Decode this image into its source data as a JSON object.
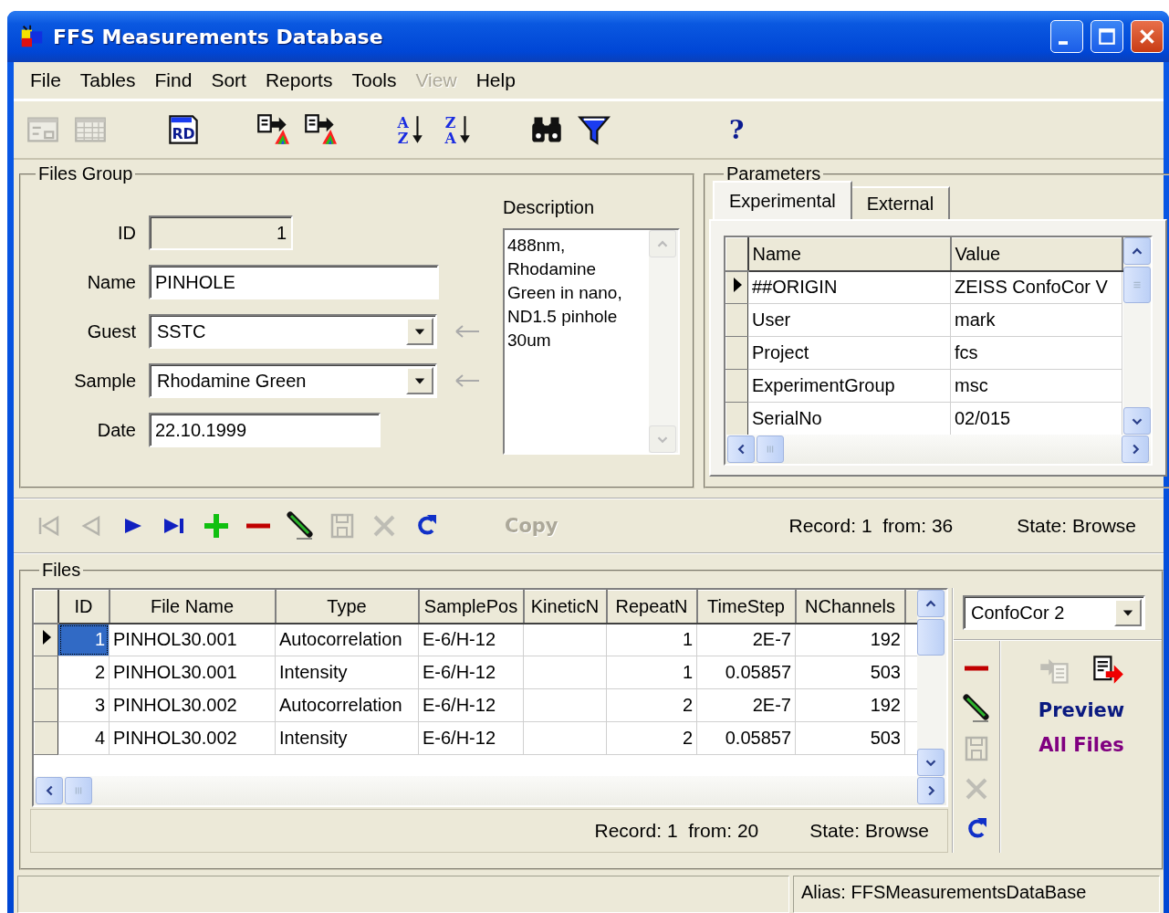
{
  "window": {
    "title": "FFS Measurements Database"
  },
  "menu": [
    {
      "label": "File",
      "disabled": false
    },
    {
      "label": "Tables",
      "disabled": false
    },
    {
      "label": "Find",
      "disabled": false
    },
    {
      "label": "Sort",
      "disabled": false
    },
    {
      "label": "Reports",
      "disabled": false
    },
    {
      "label": "Tools",
      "disabled": false
    },
    {
      "label": "View",
      "disabled": true
    },
    {
      "label": "Help",
      "disabled": false
    }
  ],
  "toolbar": [
    [
      {
        "kind": "form-view",
        "disabled": true
      },
      {
        "kind": "grid-view",
        "disabled": true
      }
    ],
    [
      {
        "kind": "report",
        "letters": "RD",
        "disabled": false
      }
    ],
    [
      {
        "kind": "copy-to",
        "disabled": false
      },
      {
        "kind": "copy-to",
        "disabled": false
      }
    ],
    [
      {
        "kind": "sort",
        "letters": [
          "A",
          "Z"
        ],
        "disabled": false
      },
      {
        "kind": "sort",
        "letters": [
          "Z",
          "A"
        ],
        "disabled": false
      }
    ],
    [
      {
        "kind": "find",
        "disabled": false
      },
      {
        "kind": "filter",
        "disabled": false
      }
    ],
    [
      {
        "kind": "help",
        "glyph": "?",
        "disabled": false
      }
    ]
  ],
  "files_group": {
    "legend": "Files Group",
    "fields": [
      {
        "label": "ID",
        "value": "1",
        "kind": "readonly"
      },
      {
        "label": "Name",
        "value": "PINHOLE",
        "kind": "text"
      },
      {
        "label": "Guest",
        "value": "SSTC",
        "kind": "combo"
      },
      {
        "label": "Sample",
        "value": "Rhodamine Green",
        "kind": "combo"
      },
      {
        "label": "Date",
        "value": "22.10.1999",
        "kind": "date"
      }
    ],
    "description": {
      "label": "Description",
      "lines": [
        "488nm,",
        "Rhodamine",
        "Green in nano,",
        "ND1.5 pinhole",
        "30um"
      ]
    }
  },
  "parameters": {
    "legend": "Parameters",
    "tabs": [
      {
        "label": "Experimental",
        "selected": true
      },
      {
        "label": "External",
        "selected": false
      }
    ],
    "columns": [
      "Name",
      "Value"
    ],
    "rows": [
      {
        "name": "##ORIGIN",
        "value": "ZEISS ConfoCor V",
        "current": true
      },
      {
        "name": "User",
        "value": "mark",
        "current": false
      },
      {
        "name": "Project",
        "value": "fcs",
        "current": false
      },
      {
        "name": "ExperimentGroup",
        "value": "msc",
        "current": false
      },
      {
        "name": "SerialNo",
        "value": "02/015",
        "current": false
      }
    ]
  },
  "navigator": {
    "buttons": [
      {
        "kind": "first",
        "disabled": true
      },
      {
        "kind": "prior",
        "disabled": true
      },
      {
        "kind": "next",
        "disabled": false
      },
      {
        "kind": "last",
        "disabled": false
      },
      {
        "kind": "add",
        "disabled": false
      },
      {
        "kind": "delete",
        "disabled": false
      },
      {
        "kind": "edit",
        "disabled": false
      },
      {
        "kind": "save",
        "disabled": true
      },
      {
        "kind": "cancel",
        "disabled": true
      },
      {
        "kind": "refresh",
        "disabled": false
      }
    ],
    "copy": {
      "label": "Copy",
      "disabled": true
    },
    "record": "Record: 1  from: 36",
    "state": "State: Browse"
  },
  "files": {
    "legend": "Files",
    "columns": [
      "ID",
      "File Name",
      "Type",
      "SamplePos",
      "KineticN",
      "RepeatN",
      "TimeStep",
      "NChannels"
    ],
    "rows": [
      {
        "cells": [
          "1",
          "PINHOL30.001",
          "Autocorrelation",
          "E-6/H-12",
          null,
          "1",
          "2E-7",
          "192"
        ],
        "current": true
      },
      {
        "cells": [
          "2",
          "PINHOL30.001",
          "Intensity",
          "E-6/H-12",
          null,
          "1",
          "0.05857",
          "503"
        ],
        "current": false
      },
      {
        "cells": [
          "3",
          "PINHOL30.002",
          "Autocorrelation",
          "E-6/H-12",
          null,
          "2",
          "2E-7",
          "192"
        ],
        "current": false
      },
      {
        "cells": [
          "4",
          "PINHOL30.002",
          "Intensity",
          "E-6/H-12",
          null,
          "2",
          "0.05857",
          "503"
        ],
        "current": false
      }
    ],
    "record": "Record: 1  from: 20",
    "state": "State: Browse",
    "device": "ConfoCor 2",
    "side_buttons": [
      {
        "kind": "delete",
        "disabled": false
      },
      {
        "kind": "edit",
        "disabled": false
      },
      {
        "kind": "save",
        "disabled": true
      },
      {
        "kind": "cancel",
        "disabled": true
      },
      {
        "kind": "refresh",
        "disabled": false
      }
    ],
    "actions": [
      {
        "kind": "import",
        "disabled": true
      },
      {
        "kind": "export",
        "disabled": false
      }
    ],
    "links": [
      {
        "label": "Preview",
        "visited": false
      },
      {
        "label": "All Files",
        "visited": true
      }
    ]
  },
  "status_bar": {
    "alias": "Alias: FFSMeasurementsDataBase"
  }
}
